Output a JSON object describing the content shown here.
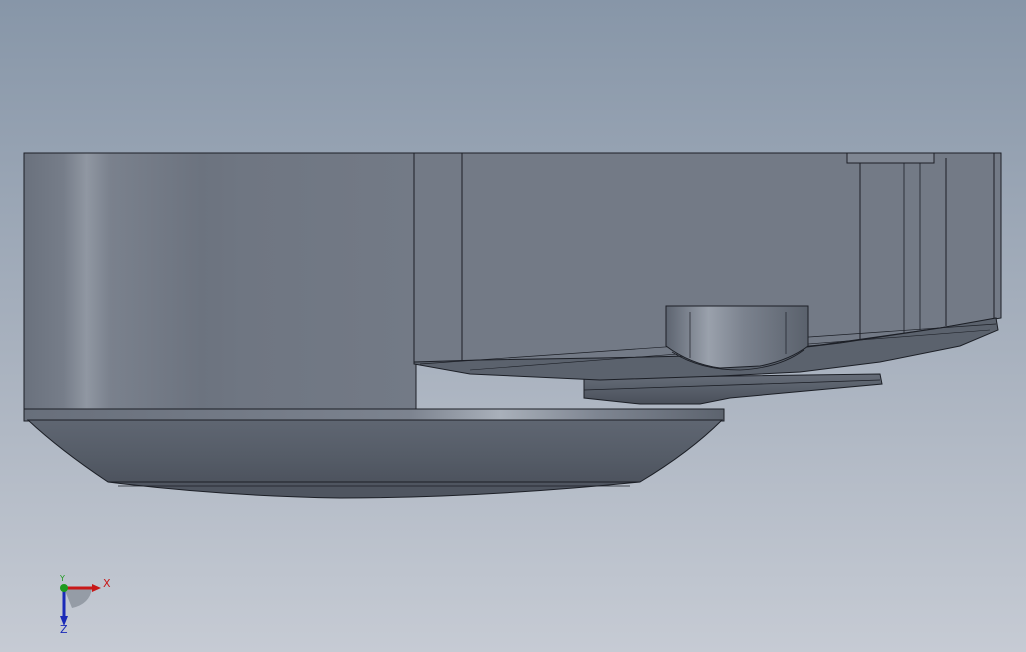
{
  "viewport": {
    "background_top": "#8796a8",
    "background_bottom": "#c6cbd4"
  },
  "model": {
    "body_color": "#737b88",
    "edge_color": "#1c1f26",
    "highlight_color": "#a2a9b4"
  },
  "triad": {
    "x_label": "X",
    "y_label": "Y",
    "z_label": "Z",
    "x_color": "#c81818",
    "y_color": "#1f9a1f",
    "z_color": "#1a2ab8"
  }
}
